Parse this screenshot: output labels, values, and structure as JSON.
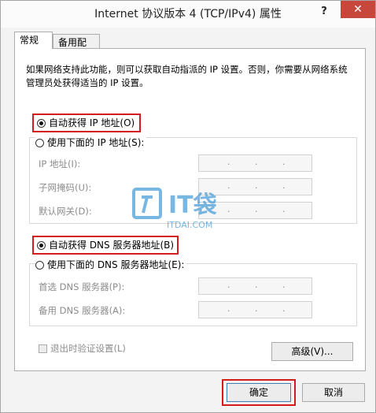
{
  "window": {
    "title": "Internet 协议版本 4 (TCP/IPv4) 属性",
    "help_glyph": "?",
    "close_glyph": "✕"
  },
  "tabs": [
    {
      "label": "常规",
      "active": true
    },
    {
      "label": "备用配置",
      "active": false
    }
  ],
  "description": "如果网络支持此功能，则可以获取自动指派的 IP 设置。否则，你需要从网络系统管理员处获得适当的 IP 设置。",
  "ip_section": {
    "auto_label": "自动获得 IP 地址(O)",
    "auto_selected": true,
    "manual_label": "使用下面的 IP 地址(S):",
    "manual_selected": false,
    "fields": [
      {
        "label": "IP 地址(I):"
      },
      {
        "label": "子网掩码(U):"
      },
      {
        "label": "默认网关(D):"
      }
    ]
  },
  "dns_section": {
    "auto_label": "自动获得 DNS 服务器地址(B)",
    "auto_selected": true,
    "manual_label": "使用下面的 DNS 服务器地址(E):",
    "manual_selected": false,
    "fields": [
      {
        "label": "首选 DNS 服务器(P):"
      },
      {
        "label": "备用 DNS 服务器(A):"
      }
    ]
  },
  "ip_dot": ".",
  "validate_checkbox": {
    "label": "退出时验证设置(L)",
    "checked": false,
    "enabled": false
  },
  "buttons": {
    "advanced": "高级(V)...",
    "ok": "确定",
    "cancel": "取消"
  },
  "watermark": {
    "brand": "IT袋",
    "url": "ITDAI.COM"
  },
  "colors": {
    "highlight": "#d41c1c",
    "close_button": "#c7473c",
    "watermark": "#4a9fd8"
  }
}
